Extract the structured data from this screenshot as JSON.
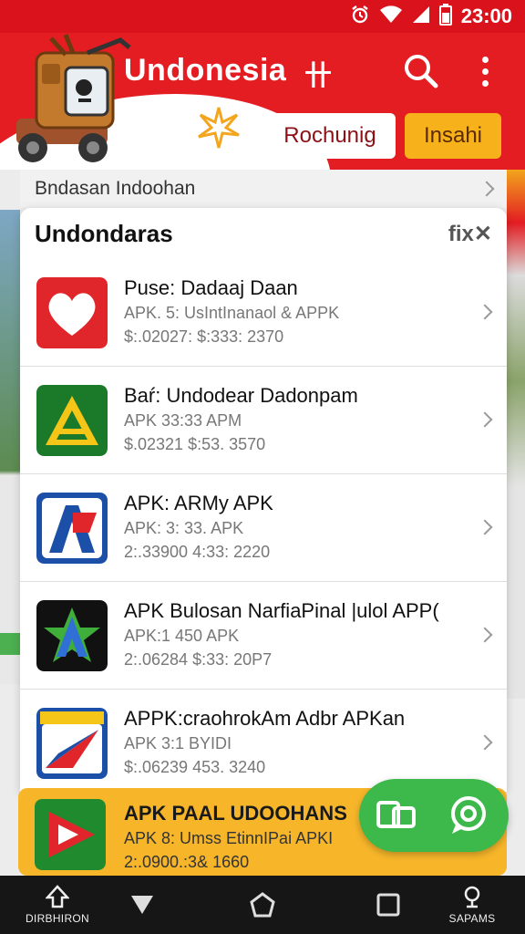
{
  "status_bar": {
    "time": "23:00",
    "icons": [
      "alarm-icon",
      "wifi-icon",
      "signal-icon",
      "battery-icon"
    ]
  },
  "header": {
    "title": "Undonesia",
    "title_glyph": "卄",
    "secondary_button": "Rochunig",
    "primary_button": "Insahi",
    "colors": {
      "brand": "#e31d22",
      "accent": "#f7b21b"
    }
  },
  "breadcrumb": {
    "label": "Bndasan Indoohan"
  },
  "list": {
    "title": "Undondaras",
    "close_label": "fix",
    "items": [
      {
        "name": "Puse: Dadaaj Daan",
        "line1": "APK. 5: UsIntInanaol & APPK",
        "line2": "$:.02027: $:333: 2370",
        "icon": "heart-app-icon"
      },
      {
        "name": "Baŕ: Undodear Dadonpam",
        "line1": "APK 33:33 APM",
        "line2": "$.02321 $:53. 3570",
        "icon": "triangle-a-app-icon"
      },
      {
        "name": "APK: ARMy APK",
        "line1": "APK: 3: 33. APK",
        "line2": "2:.33900 4:33: 2220",
        "icon": "letter-a-app-icon"
      },
      {
        "name": "APK Bulosan NarfiaPinal |ulol APP(",
        "line1": "APK:1 450 APK",
        "line2": "2:.06284 $:33: 20P7",
        "icon": "star-a-app-icon"
      },
      {
        "name": "APPK:craohrokAm Adbr APKan",
        "line1": "APK 3:1 BYIDI",
        "line2": "$:.06239 453. 3240",
        "icon": "paper-plane-app-icon"
      }
    ]
  },
  "featured": {
    "name": "APK PAAL UDOOHANS",
    "line1": "APK 8: Umss EtinnIPai APKI",
    "line2": "2:.0900.:3& 1660",
    "icon": "play-app-icon"
  },
  "nav": {
    "left_label": "DIRBHIRON",
    "right_label": "SAPAMS"
  }
}
